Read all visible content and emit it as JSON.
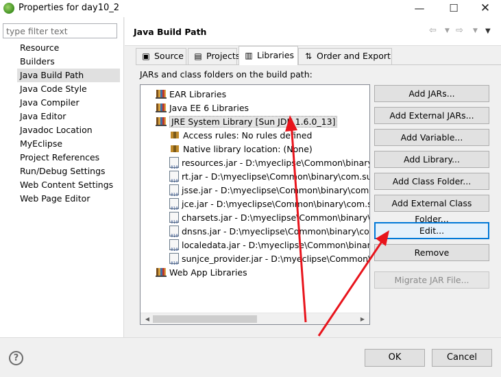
{
  "window": {
    "title": "Properties for day10_2",
    "minimize_glyph": "—",
    "maximize_glyph": "☐",
    "close_glyph": "✕"
  },
  "filter": {
    "placeholder": "type filter text",
    "value": ""
  },
  "nav": [
    "Resource",
    "Builders",
    "Java Build Path",
    "Java Code Style",
    "Java Compiler",
    "Java Editor",
    "Javadoc Location",
    "MyEclipse",
    "Project References",
    "Run/Debug Settings",
    "Web Content Settings",
    "Web Page Editor"
  ],
  "nav_selected": "Java Build Path",
  "page": {
    "title": "Java Build Path",
    "back_glyph": "⇦",
    "forward_glyph": "⇨",
    "dropdown_glyph": "▼"
  },
  "tabs": [
    {
      "label": "Source",
      "icon": "source-folder-icon",
      "glyph": "▣"
    },
    {
      "label": "Projects",
      "icon": "projects-icon",
      "glyph": "▤"
    },
    {
      "label": "Libraries",
      "icon": "libraries-icon",
      "glyph": "▥",
      "active": true
    },
    {
      "label": "Order and Export",
      "icon": "order-export-icon",
      "glyph": "⇅"
    }
  ],
  "libraries": {
    "section_label": "JARs and class folders on the build path:",
    "tree": [
      {
        "label": "EAR Libraries",
        "icon": "library-icon"
      },
      {
        "label": "Java EE 6 Libraries",
        "icon": "library-icon"
      },
      {
        "label": "JRE System Library [Sun JDK 1.6.0_13]",
        "icon": "library-icon",
        "selected": true
      },
      {
        "label": "Access rules: No rules defined",
        "icon": "access-rules-icon"
      },
      {
        "label": "Native library location: (None)",
        "icon": "native-library-icon"
      },
      {
        "label": "resources.jar - D:\\myeclipse\\Common\\binary\\com.sun.java.jdk.win32.x86_1.6.0.013\\jre\\lib",
        "icon": "jar-icon"
      },
      {
        "label": "rt.jar - D:\\myeclipse\\Common\\binary\\com.sun.java.jdk.win32.x86_1.6.0.013\\jre\\lib",
        "icon": "jar-icon"
      },
      {
        "label": "jsse.jar - D:\\myeclipse\\Common\\binary\\com.sun.java.jdk.win32.x86_1.6.0.013\\jre\\lib",
        "icon": "jar-icon"
      },
      {
        "label": "jce.jar - D:\\myeclipse\\Common\\binary\\com.sun.java.jdk.win32.x86_1.6.0.013\\jre\\lib",
        "icon": "jar-icon"
      },
      {
        "label": "charsets.jar - D:\\myeclipse\\Common\\binary\\com.sun.java.jdk.win32.x86_1.6.0.013\\jre\\lib",
        "icon": "jar-icon"
      },
      {
        "label": "dnsns.jar - D:\\myeclipse\\Common\\binary\\com.sun.java.jdk.win32.x86_1.6.0.013\\jre\\lib",
        "icon": "jar-icon"
      },
      {
        "label": "localedata.jar - D:\\myeclipse\\Common\\binary\\com.sun.java.jdk.win32.x86_1.6.0.013\\jre\\lib",
        "icon": "jar-icon"
      },
      {
        "label": "sunjce_provider.jar - D:\\myeclipse\\Common\\binary\\com.sun.java.jdk.win32.x86_1.6.0.013\\jre\\lib",
        "icon": "jar-icon"
      },
      {
        "label": "Web App Libraries",
        "icon": "library-icon"
      }
    ],
    "buttons": [
      {
        "label": "Add JARs...",
        "name": "add-jars-button"
      },
      {
        "label": "Add External JARs...",
        "name": "add-external-jars-button"
      },
      {
        "label": "Add Variable...",
        "name": "add-variable-button"
      },
      {
        "label": "Add Library...",
        "name": "add-library-button"
      },
      {
        "label": "Add Class Folder...",
        "name": "add-class-folder-button"
      },
      {
        "label": "Add External Class Folder...",
        "name": "add-external-class-folder-button"
      },
      {
        "label": "Edit...",
        "name": "edit-button",
        "focused": true
      },
      {
        "label": "Remove",
        "name": "remove-button"
      },
      {
        "label": "Migrate JAR File...",
        "name": "migrate-jar-file-button",
        "disabled": true
      }
    ]
  },
  "dialog": {
    "help_glyph": "?",
    "ok_label": "OK",
    "cancel_label": "Cancel"
  },
  "colors": {
    "annotation_red": "#e8141c",
    "focus_blue": "#0078d7"
  }
}
